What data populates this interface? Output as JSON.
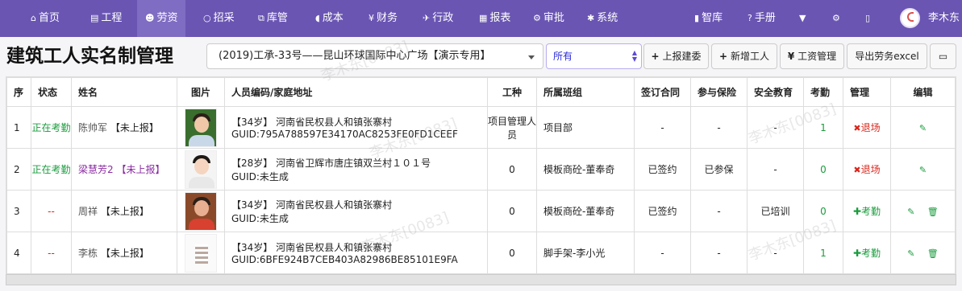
{
  "nav": {
    "items": [
      {
        "icon": "home-icon",
        "glyph": "⌂",
        "label": "首页"
      },
      {
        "icon": "project-icon",
        "glyph": "▤",
        "label": "工程"
      },
      {
        "icon": "labor-icon",
        "glyph": "☻",
        "label": "劳资"
      },
      {
        "icon": "bid-icon",
        "glyph": "○",
        "label": "招采"
      },
      {
        "icon": "warehouse-icon",
        "glyph": "⧉",
        "label": "库管"
      },
      {
        "icon": "cost-icon",
        "glyph": "◖",
        "label": "成本"
      },
      {
        "icon": "finance-icon",
        "glyph": "¥",
        "label": "财务"
      },
      {
        "icon": "admin-icon",
        "glyph": "✈",
        "label": "行政"
      },
      {
        "icon": "report-icon",
        "glyph": "▦",
        "label": "报表"
      },
      {
        "icon": "approve-icon",
        "glyph": "⚙",
        "label": "审批"
      },
      {
        "icon": "system-icon",
        "glyph": "✱",
        "label": "系统"
      }
    ],
    "right": [
      {
        "icon": "library-icon",
        "glyph": "▮",
        "label": "智库"
      },
      {
        "icon": "manual-icon",
        "glyph": "?",
        "label": "手册"
      },
      {
        "icon": "cart-icon",
        "glyph": "🛒",
        "label": ""
      },
      {
        "icon": "settings-icon",
        "glyph": "⚙",
        "label": ""
      },
      {
        "icon": "mobile-icon",
        "glyph": "▯",
        "label": ""
      }
    ],
    "user": "李木东"
  },
  "page": {
    "title": "建筑工人实名制管理",
    "project": "(2019)工承-33号——昆山环球国际中心广场【演示专用】",
    "filter": "所有",
    "buttons": {
      "report": "上报建委",
      "add": "新增工人",
      "wage": "工资管理",
      "export": "导出劳务excel"
    }
  },
  "table": {
    "headers": [
      "序",
      "状态",
      "姓名",
      "图片",
      "人员编码/家庭地址",
      "工种",
      "所属班组",
      "签订合同",
      "参与保险",
      "安全教育",
      "考勤",
      "管理",
      "编辑"
    ],
    "rows": [
      {
        "no": "1",
        "status": "正在考勤",
        "name": "陈帅军",
        "tag": "【未上报】",
        "addr": "【34岁】 河南省民权县人和镇张寨村",
        "guid": "GUID:795A788597E34170AC8253FE0FD1CEEF",
        "type": "项目管理人员",
        "team": "项目部",
        "contract": "-",
        "insurance": "-",
        "safety": "-",
        "attendance": "1",
        "manage": "退场"
      },
      {
        "no": "2",
        "status": "正在考勤",
        "name": "梁慧芳2",
        "tag": "【未上报】",
        "addr": "【28岁】 河南省卫辉市唐庄镇双兰村１０１号",
        "guid": "GUID:未生成",
        "type": "0",
        "team": "模板商砼-董奉奇",
        "contract": "已签约",
        "insurance": "已参保",
        "safety": "-",
        "attendance": "0",
        "manage": "退场"
      },
      {
        "no": "3",
        "status": "--",
        "name": "周祥",
        "tag": "【未上报】",
        "addr": "【34岁】 河南省民权县人和镇张寨村",
        "guid": "GUID:未生成",
        "type": "0",
        "team": "模板商砼-董奉奇",
        "contract": "已签约",
        "insurance": "-",
        "safety": "已培训",
        "attendance": "0",
        "manage": "考勤"
      },
      {
        "no": "4",
        "status": "--",
        "name": "李栋",
        "tag": "【未上报】",
        "addr": "【34岁】 河南省民权县人和镇张寨村",
        "guid": "GUID:6BFE924B7CEB403A82986BE85101E9FA",
        "type": "0",
        "team": "脚手架-李小光",
        "contract": "-",
        "insurance": "-",
        "safety": "-",
        "attendance": "1",
        "manage": "考勤"
      }
    ]
  },
  "watermark": "李木东[0083]"
}
